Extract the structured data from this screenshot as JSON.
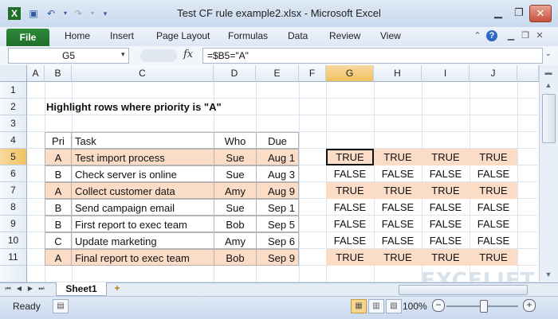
{
  "window": {
    "title": "Test CF rule example2.xlsx  -  Microsoft Excel"
  },
  "ribbon": {
    "file_label": "File",
    "tabs": [
      "Home",
      "Insert",
      "Page Layout",
      "Formulas",
      "Data",
      "Review",
      "View"
    ]
  },
  "formula_bar": {
    "name_box": "G5",
    "fx": "fx",
    "formula": "=$B5=\"A\""
  },
  "columns": [
    "A",
    "B",
    "C",
    "D",
    "E",
    "F",
    "G",
    "H",
    "I",
    "J"
  ],
  "rows": [
    "1",
    "2",
    "3",
    "4",
    "5",
    "6",
    "7",
    "8",
    "9",
    "10",
    "11"
  ],
  "selected": {
    "column": "G",
    "row": "5"
  },
  "sheet": {
    "heading": "Highlight rows where priority is \"A\"",
    "table_headers": {
      "pri": "Pri",
      "task": "Task",
      "who": "Who",
      "due": "Due"
    },
    "tasks": [
      {
        "pri": "A",
        "task": "Test import process",
        "who": "Sue",
        "due": "Aug 1",
        "highlight": true
      },
      {
        "pri": "B",
        "task": "Check server is online",
        "who": "Sue",
        "due": "Aug 3",
        "highlight": false
      },
      {
        "pri": "A",
        "task": "Collect customer data",
        "who": "Amy",
        "due": "Aug 9",
        "highlight": true
      },
      {
        "pri": "B",
        "task": "Send campaign email",
        "who": "Sue",
        "due": "Sep 1",
        "highlight": false
      },
      {
        "pri": "B",
        "task": "First report to exec team",
        "who": "Bob",
        "due": "Sep 5",
        "highlight": false
      },
      {
        "pri": "C",
        "task": "Update marketing",
        "who": "Amy",
        "due": "Sep 6",
        "highlight": false
      },
      {
        "pri": "A",
        "task": "Final report to exec team",
        "who": "Bob",
        "due": "Sep 9",
        "highlight": true
      }
    ],
    "results": [
      [
        "TRUE",
        "TRUE",
        "TRUE",
        "TRUE"
      ],
      [
        "FALSE",
        "FALSE",
        "FALSE",
        "FALSE"
      ],
      [
        "TRUE",
        "TRUE",
        "TRUE",
        "TRUE"
      ],
      [
        "FALSE",
        "FALSE",
        "FALSE",
        "FALSE"
      ],
      [
        "FALSE",
        "FALSE",
        "FALSE",
        "FALSE"
      ],
      [
        "FALSE",
        "FALSE",
        "FALSE",
        "FALSE"
      ],
      [
        "TRUE",
        "TRUE",
        "TRUE",
        "TRUE"
      ]
    ]
  },
  "sheet_tabs": [
    "Sheet1"
  ],
  "status": {
    "ready": "Ready",
    "zoom": "100%",
    "zoom_level_percent": 100
  },
  "watermark": "EXCELJET",
  "colors": {
    "highlight": "#fbdcc6",
    "file_tab": "#1f6e2a",
    "selection_header": "#f1c15f"
  },
  "icons": {
    "qat": [
      "excel-logo-icon",
      "save-icon",
      "undo-icon",
      "redo-icon",
      "customize-qat-icon"
    ],
    "window": [
      "minimize-icon",
      "restore-icon",
      "close-icon"
    ],
    "ribbon_right": [
      "minimize-ribbon-icon",
      "help-icon",
      "window-minimize-icon",
      "window-restore-icon",
      "window-close-icon"
    ]
  }
}
